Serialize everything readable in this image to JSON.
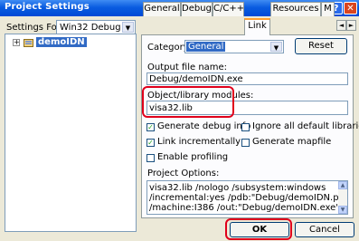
{
  "window": {
    "title": "Project Settings",
    "help_glyph": "?",
    "close_glyph": "✕"
  },
  "settings_for": {
    "label": "Settings For:",
    "value": "Win32 Debug",
    "arrow": "▼"
  },
  "tree": {
    "expander": "+",
    "project_name": "demoIDN"
  },
  "tabs": [
    {
      "label": "General"
    },
    {
      "label": "Debug"
    },
    {
      "label": "C/C++"
    },
    {
      "label": "Link",
      "active": true
    },
    {
      "label": "Resources"
    },
    {
      "label": "M"
    }
  ],
  "tab_scroll": {
    "left": "◄",
    "right": "►"
  },
  "link": {
    "category_label": "Category:",
    "category_value": "General",
    "category_arrow": "▼",
    "reset_label": "Reset",
    "output_label": "Output file name:",
    "output_value": "Debug/demoIDN.exe",
    "modules_label": "Object/library modules:",
    "modules_value": "visa32.lib",
    "checkboxes": [
      {
        "label": "Generate debug info",
        "checked": true
      },
      {
        "label": "Ignore all default libraries",
        "checked": false
      },
      {
        "label": "Link incrementally",
        "checked": true
      },
      {
        "label": "Generate mapfile",
        "checked": false
      },
      {
        "label": "Enable profiling",
        "checked": false
      }
    ],
    "check_glyph": "✓",
    "options_label": "Project Options:",
    "options_lines": [
      "visa32.lib /nologo /subsystem:windows",
      "/incremental:yes /pdb:\"Debug/demoIDN.pdb\" /debug",
      "/machine:I386 /out:\"Debug/demoIDN.exe\""
    ],
    "scroll_up": "▲",
    "scroll_down": "▼"
  },
  "buttons": {
    "ok": "OK",
    "cancel": "Cancel"
  },
  "colors": {
    "highlight_red": "#e0001b",
    "selection_blue": "#316ac5",
    "titlebar_blue": "#0a5ce0"
  }
}
